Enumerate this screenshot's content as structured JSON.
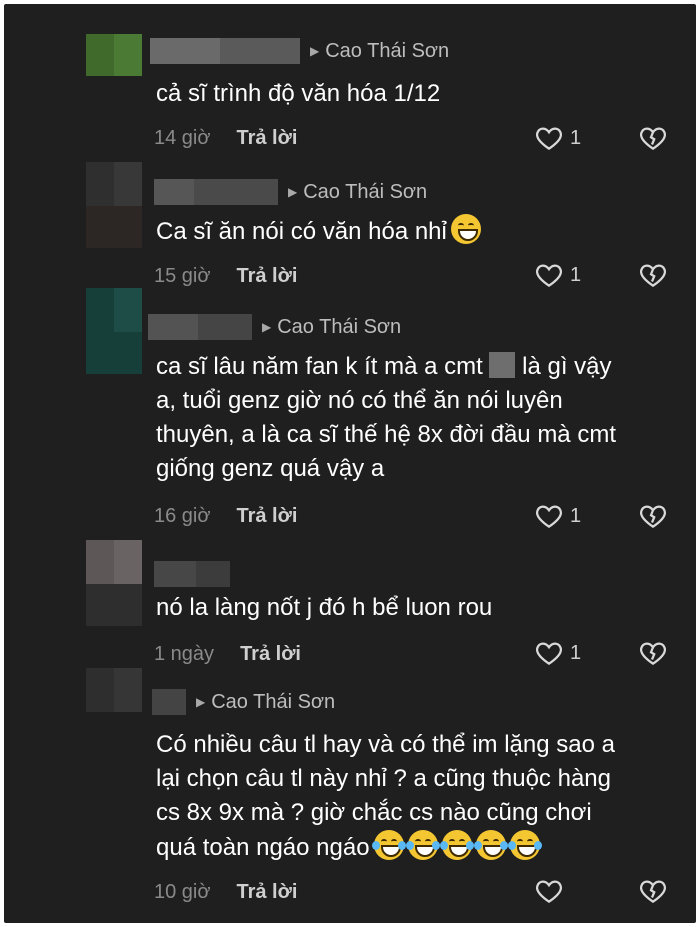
{
  "comments": [
    {
      "reply_to": "Cao Thái Sơn",
      "lines": [
        "cả sĩ trình độ văn hóa 1/12"
      ],
      "time": "14 giờ",
      "reply_label": "Trả lời",
      "likes": "1"
    },
    {
      "reply_to": "Cao Thái Sơn",
      "lines": [
        "Ca sĩ ăn nói có văn hóa nhỉ"
      ],
      "time": "15 giờ",
      "reply_label": "Trả lời",
      "likes": "1"
    },
    {
      "reply_to": "Cao Thái Sơn",
      "lines": [
        "ca sĩ lâu năm fan k ít mà a cmt",
        "a, tuổi genz giờ nó có thể ăn nói luyên",
        "thuyên, a là ca sĩ thế hệ 8x đời đầu mà cmt",
        "giống genz quá vậy a"
      ],
      "line1_tail": "là gì vậy",
      "time": "16 giờ",
      "reply_label": "Trả lời",
      "likes": "1"
    },
    {
      "lines": [
        "nó la làng nốt j đó h bể luon rou"
      ],
      "time": "1 ngày",
      "reply_label": "Trả lời",
      "likes": "1"
    },
    {
      "reply_to": "Cao Thái Sơn",
      "lines": [
        "Có nhiều câu tl hay và có thể im lặng sao a",
        "lại chọn câu tl này nhỉ ? a cũng thuộc hàng",
        "cs 8x 9x mà ? giờ chắc cs nào cũng chơi",
        "quá toàn ngáo ngáo"
      ],
      "time": "10 giờ",
      "reply_label": "Trả lời",
      "likes": ""
    }
  ],
  "icons": {
    "like": "heart-outline-icon",
    "dislike": "broken-heart-icon",
    "reply_arrow": "triangle-right-icon",
    "emoji_grin": "grinning-face-emoji",
    "emoji_cry": "laughing-crying-face-emoji"
  },
  "colors": {
    "background": "#1f1f1f",
    "text": "#ffffff",
    "secondary": "#8a8a8a"
  }
}
